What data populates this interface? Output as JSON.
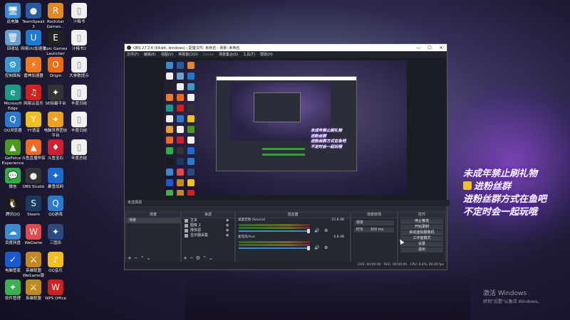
{
  "desktop_icons": [
    {
      "label": "此电脑",
      "color": "#3a8ad0",
      "glyph": "🖥"
    },
    {
      "label": "TeamSpeak\n3",
      "color": "#2a5aa0",
      "glyph": "●"
    },
    {
      "label": "Rockstar\nGames...",
      "color": "#e08a20",
      "glyph": "R"
    },
    {
      "label": "汁梅书",
      "color": "#f0f0f0",
      "glyph": "▯"
    },
    {
      "label": "回收站",
      "color": "#6aa0d0",
      "glyph": "🗑"
    },
    {
      "label": "网易UU加速器",
      "color": "#1e7ad0",
      "glyph": "U"
    },
    {
      "label": "Epic Games\nLauncher",
      "color": "#222",
      "glyph": "E"
    },
    {
      "label": "汁梅书2",
      "color": "#f0f0f0",
      "glyph": "▯"
    },
    {
      "label": "控制面板",
      "color": "#3a9ad0",
      "glyph": "⚙"
    },
    {
      "label": "雷神加速器",
      "color": "#f07a20",
      "glyph": "⚡"
    },
    {
      "label": "Origin",
      "color": "#f06a10",
      "glyph": "O"
    },
    {
      "label": "大参数提示",
      "color": "#f0f0f0",
      "glyph": "▯"
    },
    {
      "label": "Microsoft\nEdge",
      "color": "#1a9a8a",
      "glyph": "e"
    },
    {
      "label": "网易云音乐",
      "color": "#d02020",
      "glyph": "♫"
    },
    {
      "label": "SE拍最平台",
      "color": "#333",
      "glyph": "✦"
    },
    {
      "label": "丰度日结",
      "color": "#f0f0f0",
      "glyph": "▯"
    },
    {
      "label": "QQ浏览器",
      "color": "#2a7ad0",
      "glyph": "Q"
    },
    {
      "label": "YY语音",
      "color": "#f0c020",
      "glyph": "Y"
    },
    {
      "label": "电脑世界团伙\n平台",
      "color": "#f0a020",
      "glyph": "✦"
    },
    {
      "label": "丰度日结",
      "color": "#f0f0f0",
      "glyph": "▯"
    },
    {
      "label": "GeForce\nExperience",
      "color": "#4a9a20",
      "glyph": "▲"
    },
    {
      "label": "斗鱼直播伴侣",
      "color": "#f06a20",
      "glyph": "▲"
    },
    {
      "label": "斗鱼宝石",
      "color": "#d02030",
      "glyph": "♦"
    },
    {
      "label": "年度总结",
      "color": "#f0f0f0",
      "glyph": "▯"
    },
    {
      "label": "微信",
      "color": "#2ab040",
      "glyph": "💬"
    },
    {
      "label": "OBS Studio",
      "color": "#333",
      "glyph": "●"
    },
    {
      "label": "暴雪战网",
      "color": "#1a6ad0",
      "glyph": "✦"
    },
    {
      "label": "腾讯QQ",
      "color": "#1a1a1a",
      "glyph": "🐧"
    },
    {
      "label": "Steam",
      "color": "#1a3a60",
      "glyph": "S"
    },
    {
      "label": "QQ游戏",
      "color": "#2a7ad0",
      "glyph": "Q"
    },
    {
      "label": "百度网盘",
      "color": "#3a8ad0",
      "glyph": "☁"
    },
    {
      "label": "WeGame",
      "color": "#e04a4a",
      "glyph": "W"
    },
    {
      "label": "三国杀",
      "color": "#2a4a80",
      "glyph": "✦"
    },
    {
      "label": "电脑管家",
      "color": "#1a5ad0",
      "glyph": "✓"
    },
    {
      "label": "英雄联盟\nWeGame版",
      "color": "#c08a20",
      "glyph": "⚔"
    },
    {
      "label": "QQ音乐",
      "color": "#f0c020",
      "glyph": "♪"
    },
    {
      "label": "软件管理",
      "color": "#3ab050",
      "glyph": "✦"
    },
    {
      "label": "英雄联盟",
      "color": "#c08a20",
      "glyph": "⚔"
    },
    {
      "label": "WPS Office",
      "color": "#d02020",
      "glyph": "W"
    }
  ],
  "promo": {
    "line1": "未成年禁止刷礼物",
    "line2": "进粉丝群",
    "line3": "进粉丝群方式在鱼吧",
    "line4": "不定时会一起玩哦"
  },
  "watermark": {
    "line1": "激活 Windows",
    "line2": "转到\"设置\"以激活 Windows。"
  },
  "obs": {
    "title": "OBS 27.2.4 (64-bit, windows) - 配置文件: 未命名 - 场景: 未命名",
    "menu": [
      "文件(F)",
      "编辑(E)",
      "视图(V)",
      "停靠窗口(D)",
      "Docks",
      "场景集合(S)",
      "工具(T)",
      "帮助(H)"
    ],
    "preview_status": "未选择源",
    "preview_promo": [
      "未成年禁止刷礼物",
      "进粉丝群",
      "进粉丝群方式在鱼吧",
      "不定时会一起玩哦"
    ],
    "scenes": {
      "header": "场景",
      "items": [
        "场景"
      ]
    },
    "sources": {
      "header": "来源",
      "items": [
        "文本",
        "图像 2",
        "媒体源",
        "显示器采集"
      ]
    },
    "mixer": {
      "header": "混音器",
      "tracks": [
        {
          "name": "桌面音频 (Source)",
          "db": "-21.8 dB"
        },
        {
          "name": "麦克风/Aux",
          "db": "-5.8 dB"
        }
      ]
    },
    "transitions": {
      "header": "场景转场",
      "type": "渐变",
      "duration_label": "时长",
      "duration": "300 ms"
    },
    "controls": {
      "header": "控件",
      "buttons": [
        "停止推流",
        "开始录制",
        "启动虚拟摄像机",
        "工作室模式",
        "设置",
        "退出"
      ]
    },
    "statusbar": {
      "live": "LIVE: 00:00:00",
      "rec": "REC: 00:00:00",
      "cpu": "CPU: 0.4%, 60.00 fps"
    }
  }
}
